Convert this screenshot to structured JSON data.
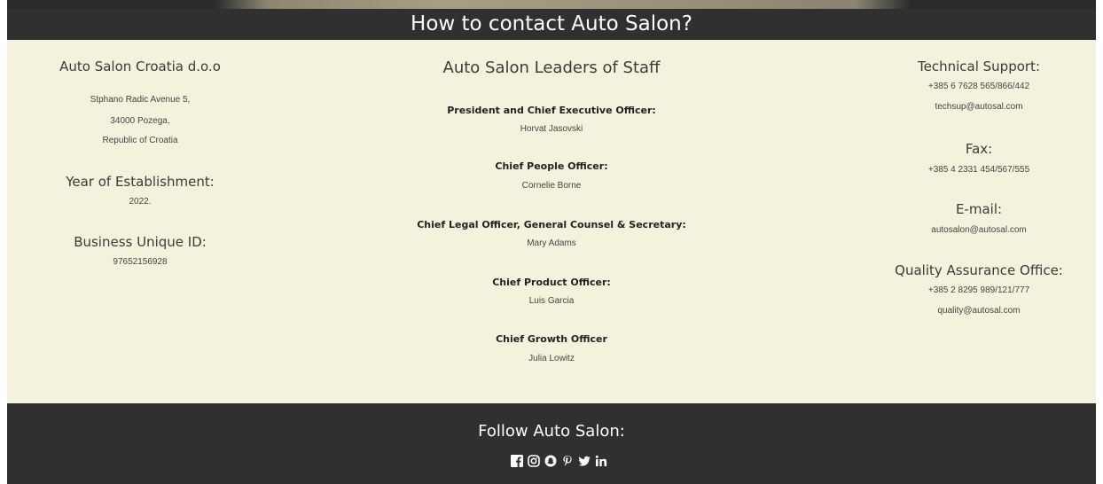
{
  "header": {
    "title": "How to contact Auto Salon?"
  },
  "company": {
    "name": "Auto Salon Croatia d.o.o",
    "address_line1": "Stphano Radic Avenue 5,",
    "address_line2": "34000 Pozega,",
    "address_line3": "Republic of Croatia",
    "year_label": "Year of Establishment:",
    "year_value": "2022.",
    "id_label": "Business Unique ID:",
    "id_value": "97652156928"
  },
  "staff": {
    "title": "Auto Salon Leaders of Staff",
    "members": [
      {
        "role": "President and Chief Executive Officer:",
        "name": "Horvat Jasovski"
      },
      {
        "role": "Chief People Officer:",
        "name": "Cornelie Borne"
      },
      {
        "role": "Chief Legal Officer, General Counsel & Secretary:",
        "name": "Mary Adams"
      },
      {
        "role": "Chief Product Officer:",
        "name": "Luis Garcia"
      },
      {
        "role": "Chief Growth Officer",
        "name": "Julia Lowitz"
      }
    ]
  },
  "contacts": {
    "tech_label": "Technical Support:",
    "tech_phone": "+385 6 7628 565/866/442",
    "tech_email": "techsup@autosal.com",
    "fax_label": "Fax:",
    "fax_value": "+385 4 2331 454/567/555",
    "email_label": "E-mail:",
    "email_value": "autosalon@autosal.com",
    "qa_label": "Quality Assurance Office:",
    "qa_phone": "+385 2 8295 989/121/777",
    "qa_email": "quality@autosal.com"
  },
  "footer": {
    "title": "Follow Auto Salon:",
    "social_icons": [
      "facebook-icon",
      "instagram-icon",
      "snapchat-icon",
      "pinterest-icon",
      "twitter-icon",
      "linkedin-icon"
    ]
  },
  "colors": {
    "dark_band": "#303030",
    "content_bg": "#f4f2dd",
    "text_white": "#ffffff"
  }
}
